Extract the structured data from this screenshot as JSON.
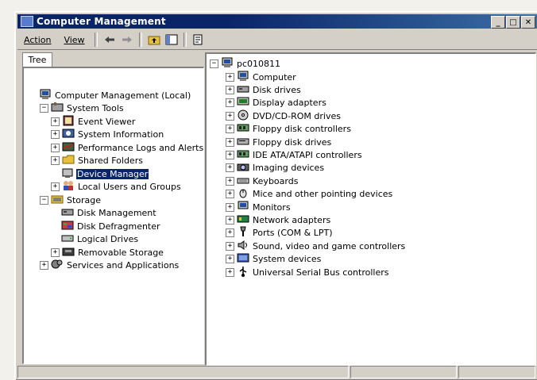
{
  "window": {
    "title": "Computer Management"
  },
  "menu": {
    "action": "Action",
    "view": "View"
  },
  "left": {
    "tab": "Tree",
    "items": [
      {
        "label": "Computer Management (Local)",
        "indent": 0,
        "expander": "",
        "icon": "computer-icon"
      },
      {
        "label": "System Tools",
        "indent": 1,
        "expander": "−",
        "icon": "tools-icon"
      },
      {
        "label": "Event Viewer",
        "indent": 2,
        "expander": "+",
        "icon": "event-viewer-icon"
      },
      {
        "label": "System Information",
        "indent": 2,
        "expander": "+",
        "icon": "info-icon"
      },
      {
        "label": "Performance Logs and Alerts",
        "indent": 2,
        "expander": "+",
        "icon": "performance-icon"
      },
      {
        "label": "Shared Folders",
        "indent": 2,
        "expander": "+",
        "icon": "folder-icon"
      },
      {
        "label": "Device Manager",
        "indent": 2,
        "expander": "",
        "icon": "device-manager-icon",
        "selected": true
      },
      {
        "label": "Local Users and Groups",
        "indent": 2,
        "expander": "+",
        "icon": "users-icon"
      },
      {
        "label": "Storage",
        "indent": 1,
        "expander": "−",
        "icon": "storage-icon"
      },
      {
        "label": "Disk Management",
        "indent": 2,
        "expander": "",
        "icon": "disk-icon"
      },
      {
        "label": "Disk Defragmenter",
        "indent": 2,
        "expander": "",
        "icon": "defrag-icon"
      },
      {
        "label": "Logical Drives",
        "indent": 2,
        "expander": "",
        "icon": "drive-icon"
      },
      {
        "label": "Removable Storage",
        "indent": 2,
        "expander": "+",
        "icon": "removable-icon"
      },
      {
        "label": "Services and Applications",
        "indent": 1,
        "expander": "+",
        "icon": "services-icon"
      }
    ]
  },
  "right": {
    "root": "pc010811",
    "items": [
      {
        "label": "Computer",
        "icon": "computer-icon"
      },
      {
        "label": "Disk drives",
        "icon": "disk-icon"
      },
      {
        "label": "Display adapters",
        "icon": "display-icon"
      },
      {
        "label": "DVD/CD-ROM drives",
        "icon": "cdrom-icon"
      },
      {
        "label": "Floppy disk controllers",
        "icon": "controller-icon"
      },
      {
        "label": "Floppy disk drives",
        "icon": "floppy-icon"
      },
      {
        "label": "IDE ATA/ATAPI controllers",
        "icon": "controller-icon"
      },
      {
        "label": "Imaging devices",
        "icon": "camera-icon"
      },
      {
        "label": "Keyboards",
        "icon": "keyboard-icon"
      },
      {
        "label": "Mice and other pointing devices",
        "icon": "mouse-icon"
      },
      {
        "label": "Monitors",
        "icon": "monitor-icon"
      },
      {
        "label": "Network adapters",
        "icon": "network-icon"
      },
      {
        "label": "Ports (COM & LPT)",
        "icon": "port-icon"
      },
      {
        "label": "Sound, video and game controllers",
        "icon": "sound-icon"
      },
      {
        "label": "System devices",
        "icon": "system-icon"
      },
      {
        "label": "Universal Serial Bus controllers",
        "icon": "usb-icon"
      }
    ]
  },
  "colors": {
    "titlebar": "#0a246a",
    "selection": "#0a246a",
    "face": "#d4d0c8"
  }
}
